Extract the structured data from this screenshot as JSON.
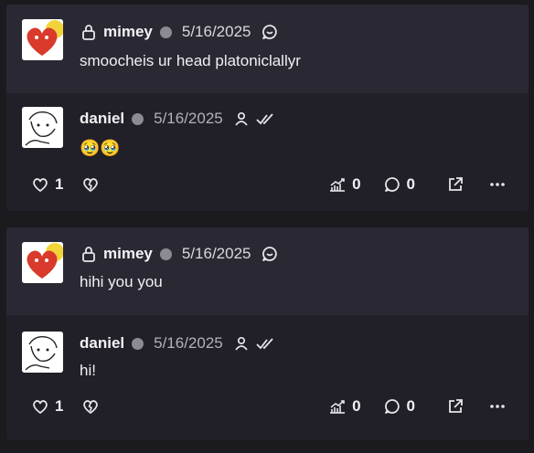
{
  "posts": [
    {
      "user": "mimey",
      "date": "5/16/2025",
      "text": "smoocheis ur head platoniclallyr",
      "icons": [
        "lock-icon",
        "status-dot",
        "quote-bubble-icon"
      ]
    },
    {
      "user": "daniel",
      "date": "5/16/2025",
      "text": "🥹🥹",
      "icons": [
        "person-icon",
        "double-check-icon"
      ],
      "actions": {
        "likes": "1",
        "boosts": "0",
        "replies": "0"
      }
    },
    {
      "user": "mimey",
      "date": "5/16/2025",
      "text": "hihi you you",
      "icons": [
        "lock-icon",
        "status-dot",
        "quote-bubble-icon"
      ]
    },
    {
      "user": "daniel",
      "date": "5/16/2025",
      "text": "hi!",
      "icons": [
        "person-icon",
        "double-check-icon"
      ],
      "actions": {
        "likes": "1",
        "boosts": "0",
        "replies": "0"
      }
    }
  ],
  "colors": {
    "background": "#1b1a1f",
    "parent_card": "#2a2832",
    "reply_card": "#211f27",
    "status_dot": "#8d8b92",
    "heart_avatar": "#d93a2b",
    "avatar_yellow": "#f2d43a"
  }
}
